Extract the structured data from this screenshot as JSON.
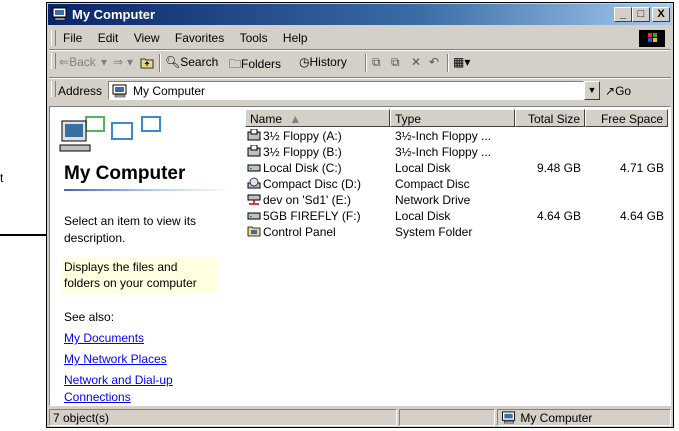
{
  "annotation": {
    "label": "t"
  },
  "window": {
    "title": "My Computer",
    "controls": {
      "minimize": "_",
      "maximize": "□",
      "close": "X"
    }
  },
  "menu": [
    "File",
    "Edit",
    "View",
    "Favorites",
    "Tools",
    "Help"
  ],
  "toolbar": {
    "back": "Back",
    "search": "Search",
    "folders": "Folders",
    "history": "History"
  },
  "address": {
    "label": "Address",
    "value": "My Computer",
    "go": "Go"
  },
  "left_pane": {
    "title": "My Computer",
    "prompt": "Select an item to view its description.",
    "tip": "Displays the files and folders on your computer",
    "see_also": "See also:",
    "links": [
      "My Documents",
      "My Network Places",
      "Network and Dial-up Connections"
    ]
  },
  "columns": {
    "name": "Name",
    "type": "Type",
    "total": "Total Size",
    "free": "Free Space"
  },
  "rows": [
    {
      "name": "3½ Floppy (A:)",
      "type": "3½-Inch Floppy ...",
      "total": "",
      "free": "",
      "icon": "floppy-icon"
    },
    {
      "name": "3½ Floppy (B:)",
      "type": "3½-Inch Floppy ...",
      "total": "",
      "free": "",
      "icon": "floppy-icon"
    },
    {
      "name": "Local Disk (C:)",
      "type": "Local Disk",
      "total": "9.48 GB",
      "free": "4.71 GB",
      "icon": "hard-disk-icon"
    },
    {
      "name": "Compact Disc (D:)",
      "type": "Compact Disc",
      "total": "",
      "free": "",
      "icon": "cd-icon"
    },
    {
      "name": "dev on 'Sd1' (E:)",
      "type": "Network Drive",
      "total": "",
      "free": "",
      "icon": "network-drive-icon"
    },
    {
      "name": "5GB FIREFLY (F:)",
      "type": "Local Disk",
      "total": "4.64 GB",
      "free": "4.64 GB",
      "icon": "hard-disk-icon"
    },
    {
      "name": "Control Panel",
      "type": "System Folder",
      "total": "",
      "free": "",
      "icon": "control-panel-icon"
    }
  ],
  "status": {
    "objects": "7 object(s)",
    "zone": "My Computer"
  }
}
